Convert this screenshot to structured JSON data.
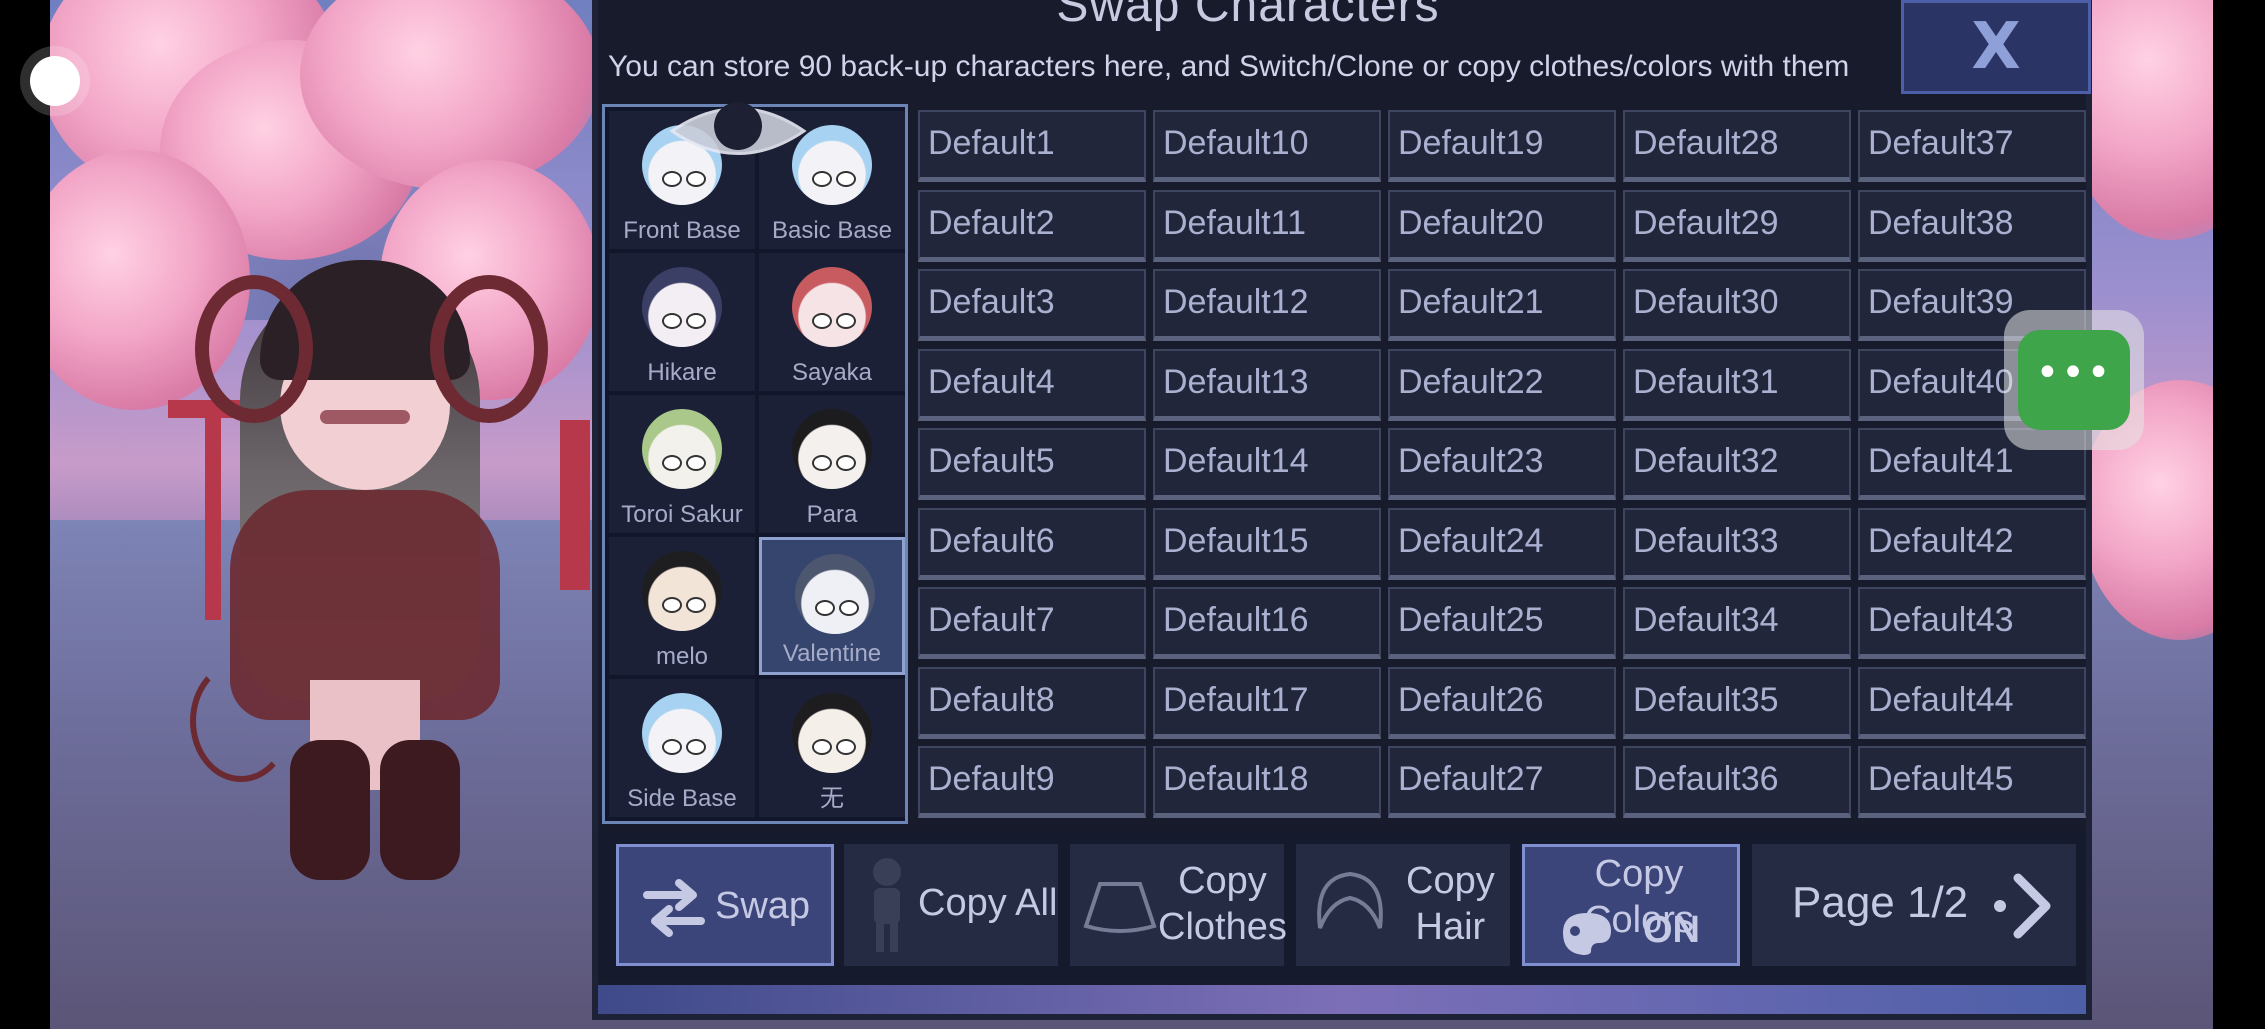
{
  "dialog": {
    "title": "Swap Characters",
    "subtitle": "You can store 90 back-up characters here, and Switch/Clone or copy clothes/colors with them",
    "close_label": "X"
  },
  "characters": [
    {
      "name": "Front Base",
      "skin": "#f3f3f7",
      "hair": "#a8d2f2",
      "selected": false
    },
    {
      "name": "Basic Base",
      "skin": "#f3f3f7",
      "hair": "#a8d2f2",
      "selected": false
    },
    {
      "name": "Hikare",
      "skin": "#f3eef3",
      "hair": "#3b3f66",
      "selected": false
    },
    {
      "name": "Sayaka",
      "skin": "#f5e3e6",
      "hair": "#c85b5f",
      "selected": false
    },
    {
      "name": "Toroi Sakur",
      "skin": "#f3f1ec",
      "hair": "#a9c889",
      "selected": false
    },
    {
      "name": "Para",
      "skin": "#f4f0ee",
      "hair": "#1c1b1d",
      "selected": false
    },
    {
      "name": "melo",
      "skin": "#f3e4d8",
      "hair": "#1e1d20",
      "selected": false
    },
    {
      "name": "Valentine",
      "skin": "#eef0f6",
      "hair": "#4d566f",
      "selected": true
    },
    {
      "name": "Side Base",
      "skin": "#f3f3f7",
      "hair": "#a8d2f2",
      "selected": false
    },
    {
      "name": "无",
      "skin": "#f4efe9",
      "hair": "#1d1c1f",
      "selected": false
    }
  ],
  "slots": [
    [
      "Default1",
      "Default2",
      "Default3",
      "Default4",
      "Default5",
      "Default6",
      "Default7",
      "Default8",
      "Default9"
    ],
    [
      "Default10",
      "Default11",
      "Default12",
      "Default13",
      "Default14",
      "Default15",
      "Default16",
      "Default17",
      "Default18"
    ],
    [
      "Default19",
      "Default20",
      "Default21",
      "Default22",
      "Default23",
      "Default24",
      "Default25",
      "Default26",
      "Default27"
    ],
    [
      "Default28",
      "Default29",
      "Default30",
      "Default31",
      "Default32",
      "Default33",
      "Default34",
      "Default35",
      "Default36"
    ],
    [
      "Default37",
      "Default38",
      "Default39",
      "Default40",
      "Default41",
      "Default42",
      "Default43",
      "Default44",
      "Default45"
    ]
  ],
  "actions": {
    "swap": "Swap",
    "copy_all": "Copy All",
    "copy_clothes_1": "Copy",
    "copy_clothes_2": "Clothes",
    "copy_hair_1": "Copy",
    "copy_hair_2": "Hair",
    "copy_colors_1": "Copy Colors",
    "copy_colors_2": "ON",
    "page": "Page 1/2"
  },
  "icons": {
    "close": "close-icon",
    "swap": "swap-arrows-icon",
    "copy_all": "body-silhouette-icon",
    "copy_clothes": "skirt-icon",
    "copy_hair": "hair-icon",
    "copy_colors": "paint-palette-icon",
    "next_page": "chevron-right-icon",
    "more": "more-dots-icon",
    "toggle_view": "eye-icon"
  },
  "colors": {
    "panel": "#171b2c",
    "accent": "#3c4579",
    "more_button": "#3fa54a"
  }
}
